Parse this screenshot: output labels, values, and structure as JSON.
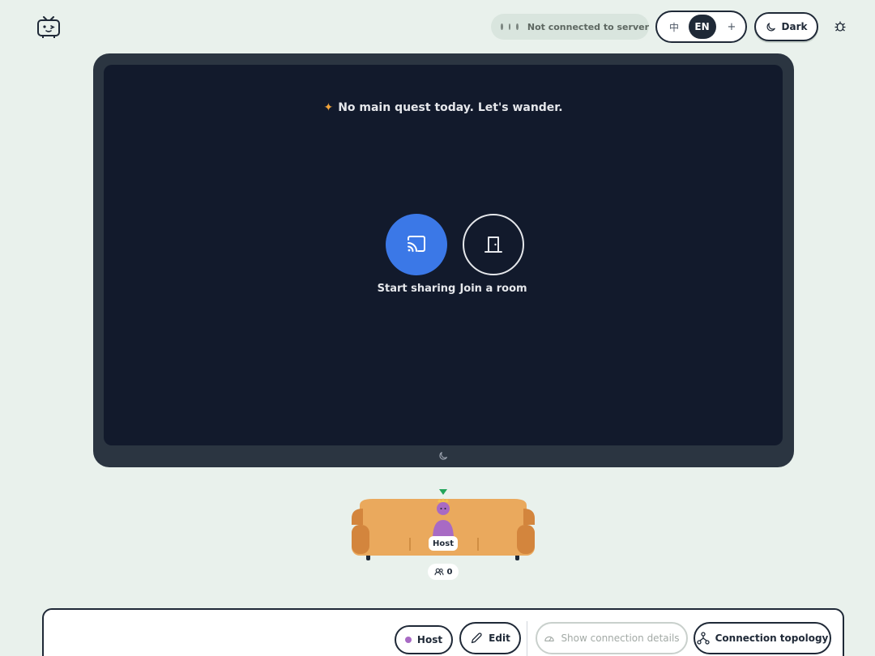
{
  "header": {
    "logo_icon": "tv-face-icon",
    "status": {
      "text": "Not connected to server",
      "dot_color": "#7b8580"
    },
    "language": {
      "zh_label": "中",
      "en_label": "EN",
      "add_label": "+"
    },
    "theme_button_label": "Dark",
    "debug_icon": "bug-icon"
  },
  "screen": {
    "tagline": "No main quest today. Let's wander.",
    "start_sharing_label": "Start sharing",
    "join_room_label": "Join a room",
    "accent_color": "#3b78e7",
    "tagline_spark_color": "#f0a23a"
  },
  "lounge": {
    "host_tag": "Host",
    "viewer_count": "0",
    "couch_color": "#eaa95d",
    "host_avatar_color": "#a86ac4"
  },
  "bottom_bar": {
    "host_label": "Host",
    "edit_label": "Edit",
    "show_details_label": "Show connection details",
    "topology_label": "Connection topology"
  }
}
